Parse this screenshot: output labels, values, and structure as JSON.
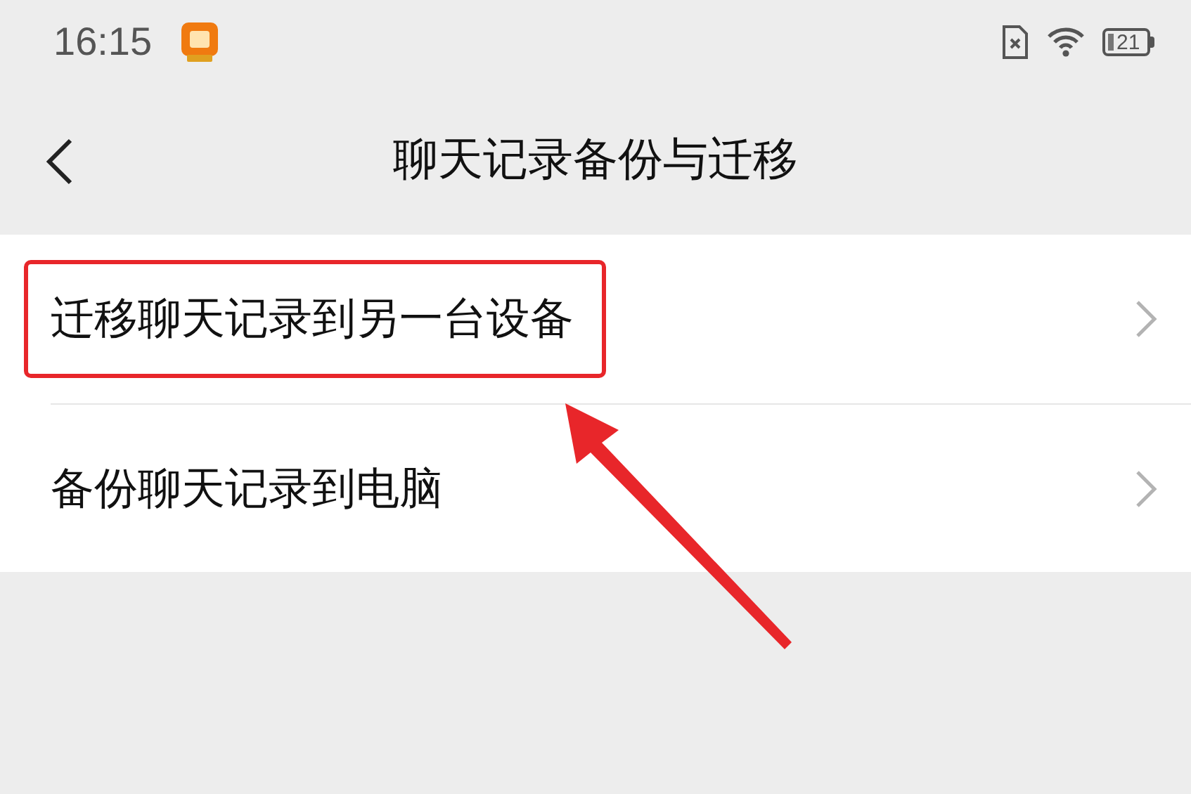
{
  "status_bar": {
    "time": "16:15",
    "battery": "21"
  },
  "header": {
    "title": "聊天记录备份与迁移"
  },
  "items": [
    {
      "label": "迁移聊天记录到另一台设备",
      "highlighted": true
    },
    {
      "label": "备份聊天记录到电脑",
      "highlighted": false
    }
  ]
}
